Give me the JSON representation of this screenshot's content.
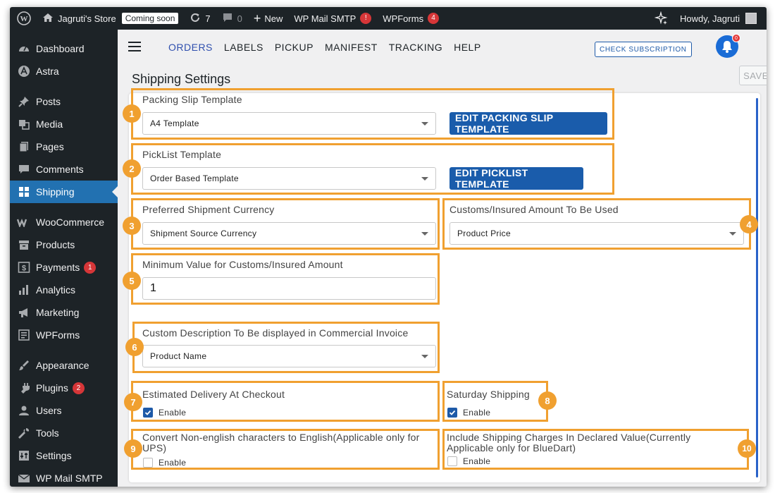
{
  "adminbar": {
    "site_name": "Jagruti's Store",
    "coming_soon": "Coming soon",
    "updates_count": "7",
    "comments_count": "0",
    "new_label": "New",
    "wp_mail_smtp": "WP Mail SMTP",
    "wp_mail_badge": "!",
    "wpforms": "WPForms",
    "wpforms_badge": "4",
    "howdy": "Howdy, Jagruti"
  },
  "sidebar": {
    "items": [
      {
        "label": "Dashboard",
        "icon": "dashboard-icon"
      },
      {
        "label": "Astra",
        "icon": "astra-icon"
      },
      {
        "label": "Posts",
        "icon": "pin-icon"
      },
      {
        "label": "Media",
        "icon": "media-icon"
      },
      {
        "label": "Pages",
        "icon": "pages-icon"
      },
      {
        "label": "Comments",
        "icon": "comment-icon"
      },
      {
        "label": "Shipping",
        "icon": "grid-icon",
        "active": true
      },
      {
        "label": "WooCommerce",
        "icon": "woo-icon"
      },
      {
        "label": "Products",
        "icon": "archive-icon"
      },
      {
        "label": "Payments",
        "icon": "dollar-icon",
        "badge": "1"
      },
      {
        "label": "Analytics",
        "icon": "bar-chart-icon"
      },
      {
        "label": "Marketing",
        "icon": "megaphone-icon"
      },
      {
        "label": "WPForms",
        "icon": "form-icon"
      },
      {
        "label": "Appearance",
        "icon": "brush-icon"
      },
      {
        "label": "Plugins",
        "icon": "plug-icon",
        "badge": "2"
      },
      {
        "label": "Users",
        "icon": "user-icon"
      },
      {
        "label": "Tools",
        "icon": "wrench-icon"
      },
      {
        "label": "Settings",
        "icon": "settings-icon"
      },
      {
        "label": "WP Mail SMTP",
        "icon": "mail-icon"
      }
    ]
  },
  "nav": {
    "tabs": [
      "ORDERS",
      "LABELS",
      "PICKUP",
      "MANIFEST",
      "TRACKING",
      "HELP"
    ],
    "check_subscription": "CHECK SUBSCRIPTION",
    "bell_badge": "0",
    "save": "SAVE"
  },
  "page_title": "Shipping Settings",
  "fields": {
    "packing_slip": {
      "label": "Packing Slip Template",
      "value": "A4 Template",
      "button": "EDIT PACKING SLIP TEMPLATE",
      "marker": "1"
    },
    "picklist": {
      "label": "PickList Template",
      "value": "Order Based Template",
      "button": "EDIT PICKLIST TEMPLATE",
      "marker": "2"
    },
    "currency": {
      "label": "Preferred Shipment Currency",
      "value": "Shipment Source Currency",
      "marker": "3"
    },
    "customs_amount": {
      "label": "Customs/Insured Amount To Be Used",
      "value": "Product Price",
      "marker": "4"
    },
    "min_value": {
      "label": "Minimum Value for Customs/Insured Amount",
      "value": "1",
      "marker": "5"
    },
    "custom_desc": {
      "label": "Custom Description To Be displayed in Commercial Invoice",
      "value": "Product Name",
      "marker": "6"
    },
    "est_delivery": {
      "label": "Estimated Delivery At Checkout",
      "check": "Enable",
      "checked": true,
      "marker": "7"
    },
    "saturday": {
      "label": "Saturday Shipping",
      "check": "Enable",
      "checked": true,
      "marker": "8"
    },
    "non_english": {
      "label_line1": "Convert Non-english characters to English(Applicable only for",
      "label_line2": "UPS)",
      "check": "Enable",
      "checked": false,
      "marker": "9"
    },
    "shipping_charges": {
      "label_line1": "Include Shipping Charges In Declared Value(Currently",
      "label_line2": "Applicable only for BlueDart)",
      "check": "Enable",
      "checked": false,
      "marker": "10"
    }
  },
  "colors": {
    "highlight": "#f0a030",
    "primary": "#1a5cab",
    "wp_blue": "#2271b1",
    "admin_dark": "#1d2327"
  }
}
